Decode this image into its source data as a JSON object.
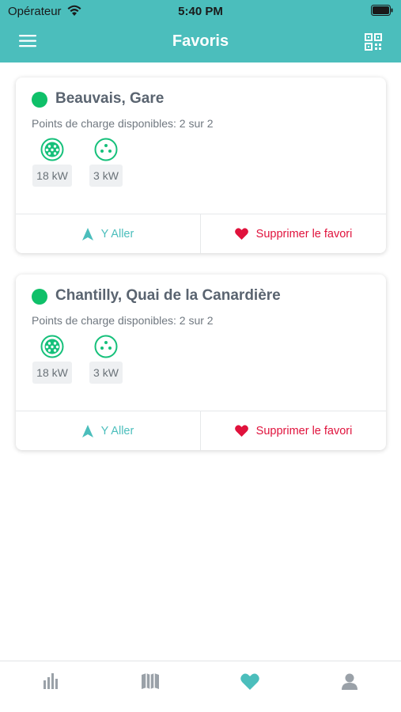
{
  "status_bar": {
    "carrier": "Opérateur",
    "time": "5:40 PM"
  },
  "nav": {
    "title": "Favoris",
    "menu_icon": "menu-icon",
    "qr_icon": "qr-code-icon"
  },
  "favorites": [
    {
      "name": "Beauvais, Gare",
      "status_color": "#0fc069",
      "availability": "Points de charge disponibles: 2 sur 2",
      "connectors": [
        {
          "icon": "type2-plug-icon",
          "power": "18 kW"
        },
        {
          "icon": "domestic-plug-icon",
          "power": "3 kW"
        }
      ],
      "go_label": "Y Aller",
      "remove_label": "Supprimer le favori"
    },
    {
      "name": "Chantilly, Quai de la Canardière",
      "status_color": "#0fc069",
      "availability": "Points de charge disponibles: 2 sur 2",
      "connectors": [
        {
          "icon": "type2-plug-icon",
          "power": "18 kW"
        },
        {
          "icon": "domestic-plug-icon",
          "power": "3 kW"
        }
      ],
      "go_label": "Y Aller",
      "remove_label": "Supprimer le favori"
    }
  ],
  "tabbar": {
    "tabs": [
      {
        "icon": "stats-icon",
        "active": false
      },
      {
        "icon": "map-icon",
        "active": false
      },
      {
        "icon": "heart-icon",
        "active": true
      },
      {
        "icon": "profile-icon",
        "active": false
      }
    ]
  },
  "colors": {
    "brand": "#4bbebc",
    "available": "#0fc069",
    "danger": "#e0123c"
  }
}
